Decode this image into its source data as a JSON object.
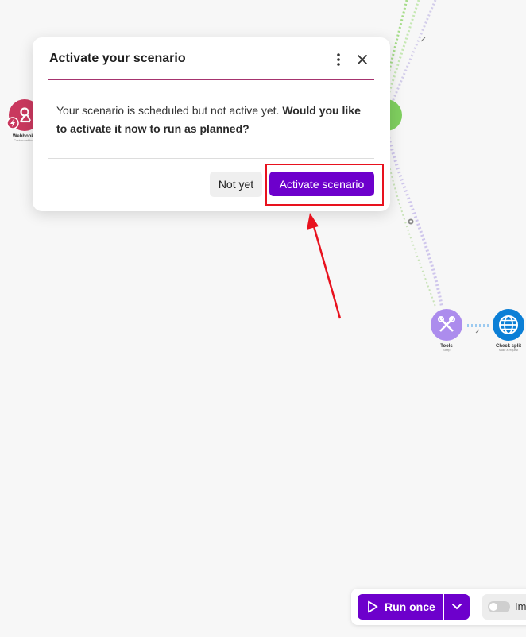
{
  "dialog": {
    "title": "Activate your scenario",
    "message_plain": "Your scenario is scheduled but not active yet. ",
    "message_bold": "Would you like to activate it now to run as planned?",
    "not_yet_label": "Not yet",
    "activate_label": "Activate scenario",
    "accent_color": "#a6346f",
    "more_icon": "vertical-ellipsis-icon",
    "close_icon": "close-icon"
  },
  "canvas": {
    "modules": [
      {
        "name": "Webhooks",
        "subtitle": "Custom webhook",
        "color": "#c9385e",
        "icon": "webhook-icon"
      },
      {
        "name": "Tools",
        "subtitle": "Sleep",
        "color": "#ac8ced",
        "icon": "tools-icon"
      },
      {
        "name": "Check split",
        "subtitle": "Make a request",
        "color": "#0b7fd6",
        "icon": "globe-icon"
      }
    ]
  },
  "toolbar": {
    "run_once_label": "Run once",
    "schedule_label": "Im",
    "brand_color": "#6d00cc",
    "run_icon": "play-icon",
    "dropdown_icon": "chevron-down-icon"
  },
  "annotation": {
    "color": "#e8121e"
  }
}
